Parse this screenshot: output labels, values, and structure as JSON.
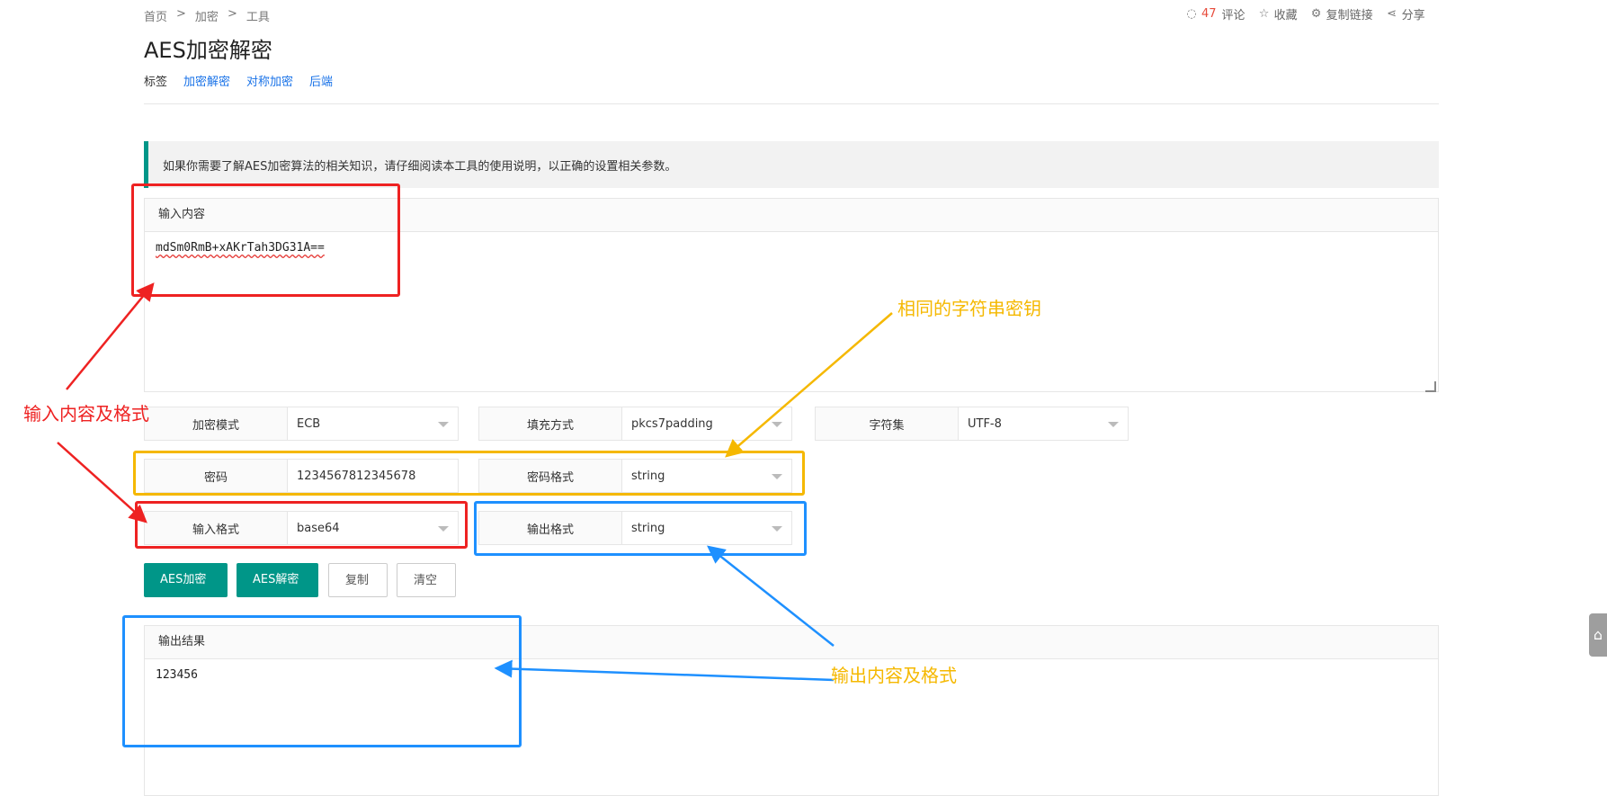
{
  "breadcrumb": [
    "首页",
    "加密",
    "工具"
  ],
  "breadcrumb_sep": ">",
  "page_title": "AES加密解密",
  "tags": {
    "label": "标签",
    "items": [
      "加密解密",
      "对称加密",
      "后端"
    ]
  },
  "actions": {
    "comment_count": "47",
    "comment_label": "评论",
    "favorite": "收藏",
    "copy_link": "复制链接",
    "share": "分享"
  },
  "notice": "如果你需要了解AES加密算法的相关知识，请仔细阅读本工具的使用说明，以正确的设置相关参数。",
  "input_panel": {
    "title": "输入内容",
    "value": "mdSm0RmB+xAKrTah3DG31A=="
  },
  "form": {
    "mode": {
      "label": "加密模式",
      "value": "ECB"
    },
    "padding": {
      "label": "填充方式",
      "value": "pkcs7padding"
    },
    "charset": {
      "label": "字符集",
      "value": "UTF-8"
    },
    "password": {
      "label": "密码",
      "value": "1234567812345678"
    },
    "password_format": {
      "label": "密码格式",
      "value": "string"
    },
    "input_format": {
      "label": "输入格式",
      "value": "base64"
    },
    "output_format": {
      "label": "输出格式",
      "value": "string"
    }
  },
  "buttons": {
    "encrypt": "AES加密",
    "decrypt": "AES解密",
    "copy": "复制",
    "clear": "清空"
  },
  "output_panel": {
    "title": "输出结果",
    "value": "123456"
  },
  "annotations": {
    "input_note": "输入内容及格式",
    "key_note": "相同的字符串密钥",
    "output_note": "输出内容及格式"
  },
  "colors": {
    "accent": "#009688",
    "red": "#ee2222",
    "yellow": "#f5b800",
    "blue": "#1e90ff"
  }
}
